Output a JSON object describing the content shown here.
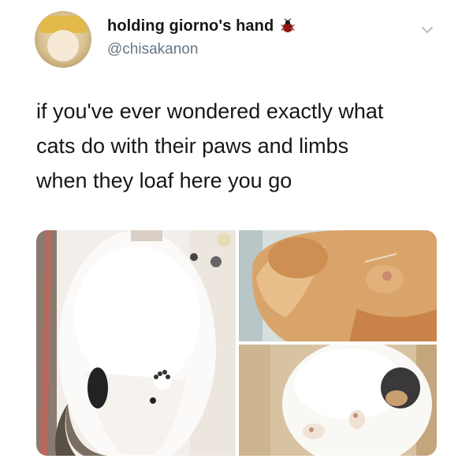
{
  "tweet": {
    "author": {
      "display_name": "holding giorno's hand",
      "handle": "@chisakanon",
      "name_badge_icon": "ladybug-icon",
      "avatar_icon": "avatar-image"
    },
    "menu_icon": "chevron-down-icon",
    "text_lines": [
      "if you've ever wondered exactly what",
      "cats do with their paws and limbs",
      "when they loaf here you go"
    ],
    "media": {
      "count": 3,
      "photos": [
        "cat-belly-on-glass-photo",
        "orange-cat-paws-photo",
        "white-cat-on-glass-photo"
      ]
    },
    "colors": {
      "text": "#14171a",
      "secondary_text": "#657786",
      "background": "#ffffff"
    }
  }
}
